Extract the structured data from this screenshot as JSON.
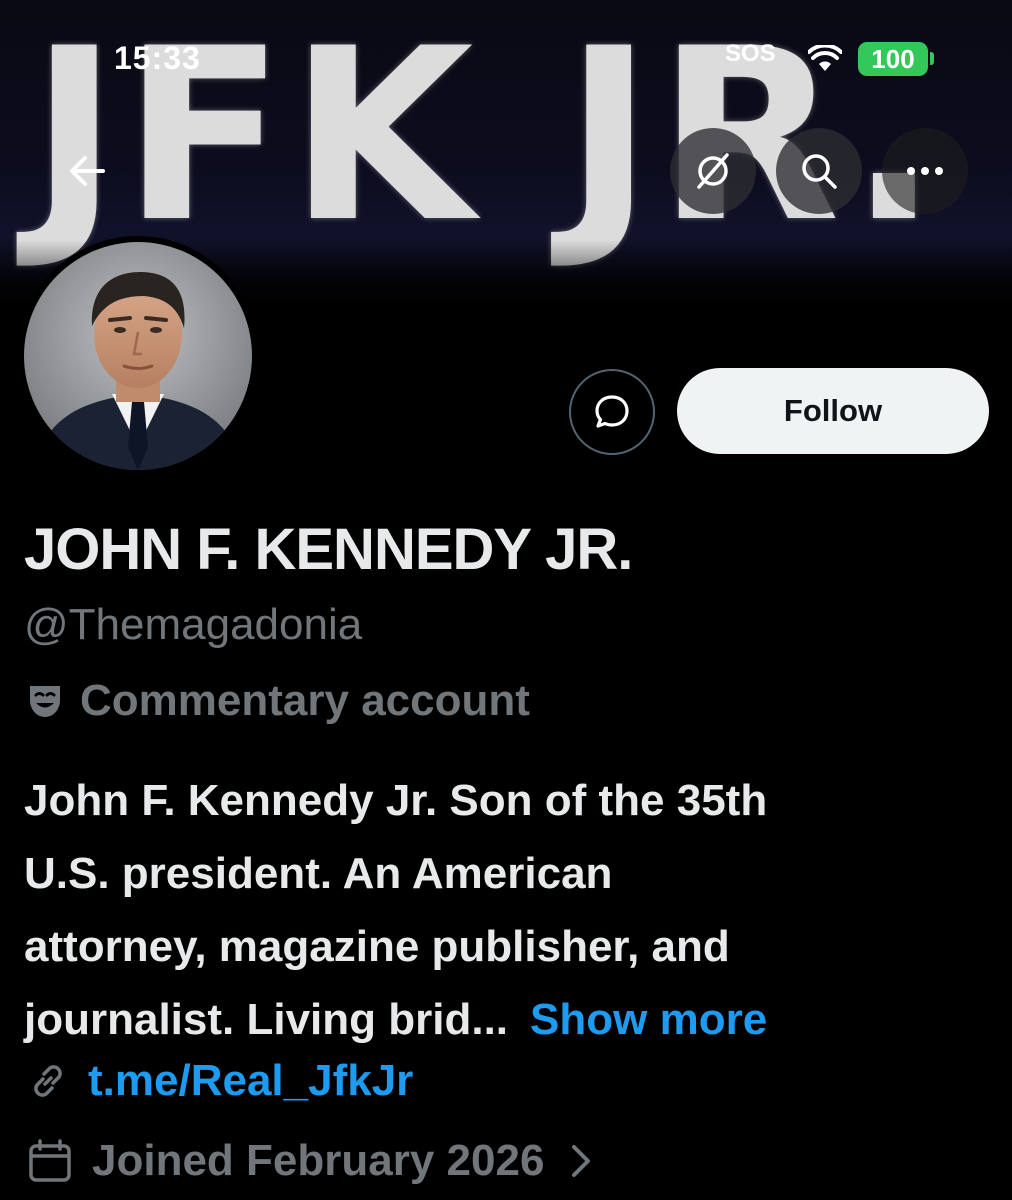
{
  "status_bar": {
    "time": "15:33",
    "carrier": "SOS",
    "battery": "100",
    "battery_color": "#34c759"
  },
  "banner": {
    "text": "JFK JR."
  },
  "nav": {
    "back_icon": "arrow-left-icon",
    "grok_icon": "grok-icon",
    "search_icon": "search-icon",
    "more_icon": "more-horizontal-icon"
  },
  "actions": {
    "dm_icon": "message-bubble-icon",
    "follow_label": "Follow"
  },
  "profile": {
    "display_name": "JOHN F. KENNEDY JR.",
    "handle": "@Themagadonia",
    "label_icon": "theater-mask-icon",
    "label": "Commentary account",
    "bio_lines": [
      "John F. Kennedy Jr. Son of the 35th",
      "U.S. president. An American",
      "attorney, magazine publisher, and",
      "journalist. Living brid..."
    ],
    "show_more": "Show more",
    "link": "t.me/Real_JfkJr",
    "joined": "Joined February 2026"
  },
  "colors": {
    "background": "#000000",
    "primary_text": "#e7e9ea",
    "secondary_text": "#71767b",
    "accent_blue": "#1d9bf0",
    "follow_bg": "#eff3f4"
  }
}
